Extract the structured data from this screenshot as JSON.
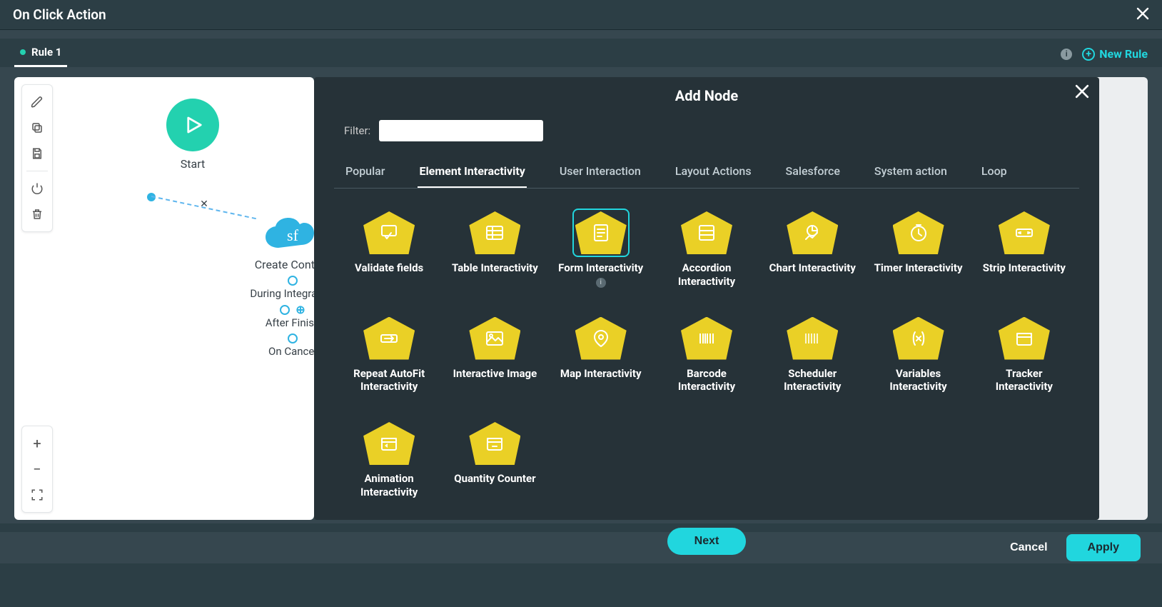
{
  "header": {
    "title": "On Click Action"
  },
  "tabs": {
    "rule_label": "Rule 1",
    "new_rule": "New Rule"
  },
  "flow": {
    "start": "Start",
    "node": "Create Contact",
    "sf": "sf",
    "during": "During Integration",
    "after": "After Finish",
    "cancel": "On Cancel"
  },
  "modal": {
    "title": "Add Node",
    "filter_label": "Filter:",
    "filter_value": "",
    "categories": [
      "Popular",
      "Element Interactivity",
      "User Interaction",
      "Layout Actions",
      "Salesforce",
      "System action",
      "Loop"
    ],
    "active_category": 1,
    "nodes": [
      {
        "label": "Validate fields",
        "icon": "validate"
      },
      {
        "label": "Table Interactivity",
        "icon": "table"
      },
      {
        "label": "Form Interactivity",
        "icon": "form",
        "selected": true,
        "info": true
      },
      {
        "label": "Accordion Interactivity",
        "icon": "accordion"
      },
      {
        "label": "Chart Interactivity",
        "icon": "chart"
      },
      {
        "label": "Timer Interactivity",
        "icon": "timer"
      },
      {
        "label": "Strip Interactivity",
        "icon": "strip"
      },
      {
        "label": "Repeat AutoFit Interactivity",
        "icon": "repeat"
      },
      {
        "label": "Interactive Image",
        "icon": "image"
      },
      {
        "label": "Map Interactivity",
        "icon": "map"
      },
      {
        "label": "Barcode Interactivity",
        "icon": "barcode"
      },
      {
        "label": "Scheduler Interactivity",
        "icon": "scheduler"
      },
      {
        "label": "Variables Interactivity",
        "icon": "variables"
      },
      {
        "label": "Tracker Interactivity",
        "icon": "tracker"
      },
      {
        "label": "Animation Interactivity",
        "icon": "animation"
      },
      {
        "label": "Quantity Counter",
        "icon": "quantity"
      }
    ],
    "next": "Next"
  },
  "footer": {
    "cancel": "Cancel",
    "apply": "Apply"
  }
}
